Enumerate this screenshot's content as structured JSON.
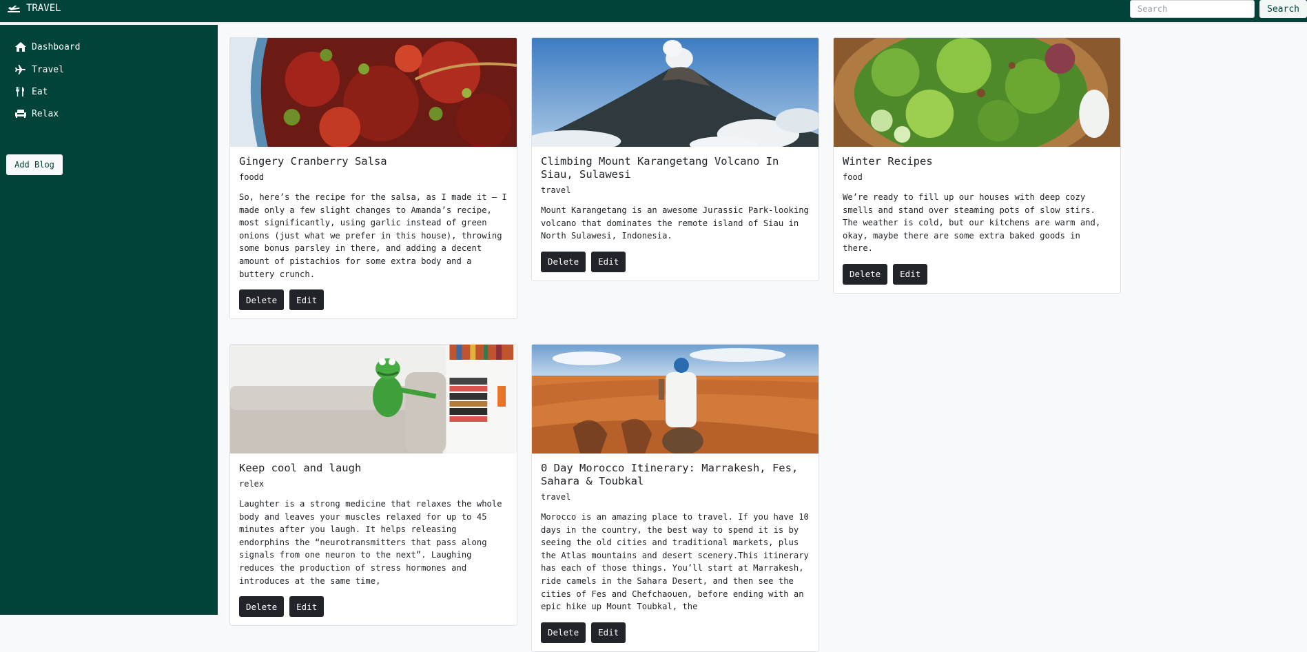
{
  "app": {
    "brand": "TRAVEL",
    "brand_icon": "plane-icon",
    "theme_color": "#014338"
  },
  "header": {
    "search": {
      "placeholder": "Search",
      "value": ""
    },
    "search_button": "Search"
  },
  "sidebar": {
    "items": [
      {
        "label": "Dashboard",
        "icon": "home-icon"
      },
      {
        "label": "Travel",
        "icon": "plane-icon"
      },
      {
        "label": "Eat",
        "icon": "utensils-icon"
      },
      {
        "label": "Relax",
        "icon": "couch-icon"
      }
    ],
    "add_button": "Add Blog"
  },
  "posts": [
    {
      "title": "Gingery Cranberry Salsa",
      "category": "foodd",
      "text": "So, here’s the recipe for the salsa, as I made it – I made only a few slight changes to Amanda’s recipe, most significantly, using garlic instead of green onions (just what we prefer in this house), throwing some bonus parsley in there, and adding a decent amount of pistachios for some extra body and a buttery crunch.",
      "image": "cranberry-salsa-photo",
      "delete_label": "Delete",
      "edit_label": "Edit"
    },
    {
      "title": "Climbing Mount Karangetang Volcano In Siau, Sulawesi",
      "category": "travel",
      "text": "Mount Karangetang is an awesome Jurassic Park-looking volcano that dominates the remote island of Siau in North Sulawesi, Indonesia.",
      "image": "volcano-photo",
      "delete_label": "Delete",
      "edit_label": "Edit"
    },
    {
      "title": "Winter Recipes",
      "category": "food",
      "text": "We’re ready to fill up our houses with deep cozy smells and stand over steaming pots of slow stirs. The weather is cold, but our kitchens are warm and, okay, maybe there are some extra baked goods in there.",
      "image": "salad-photo",
      "delete_label": "Delete",
      "edit_label": "Edit"
    },
    {
      "title": "Keep cool and laugh",
      "category": "relex",
      "text": "Laughter is a strong medicine that relaxes the whole body and leaves your muscles relaxed for up to 45 minutes after you laugh. It helps releasing endorphins the “neurotransmitters that pass along signals from one neuron to the next”. Laughing reduces the production of stress hormones and introduces at the same time,",
      "image": "kermit-sofa-photo",
      "delete_label": "Delete",
      "edit_label": "Edit"
    },
    {
      "title": "0 Day Morocco Itinerary: Marrakesh, Fes, Sahara & Toubkal",
      "category": "travel",
      "text": "Morocco is an amazing place to travel. If you have 10 days in the country, the best way to spend it is by seeing the old cities and traditional markets, plus the Atlas mountains and desert scenery.This itinerary has each of those things. You’ll start at Marrakesh, ride camels in the Sahara Desert, and then see the cities of Fes and Chefchaouen, before ending with an epic hike up Mount Toubkal, the",
      "image": "sahara-camel-photo",
      "delete_label": "Delete",
      "edit_label": "Edit"
    }
  ]
}
